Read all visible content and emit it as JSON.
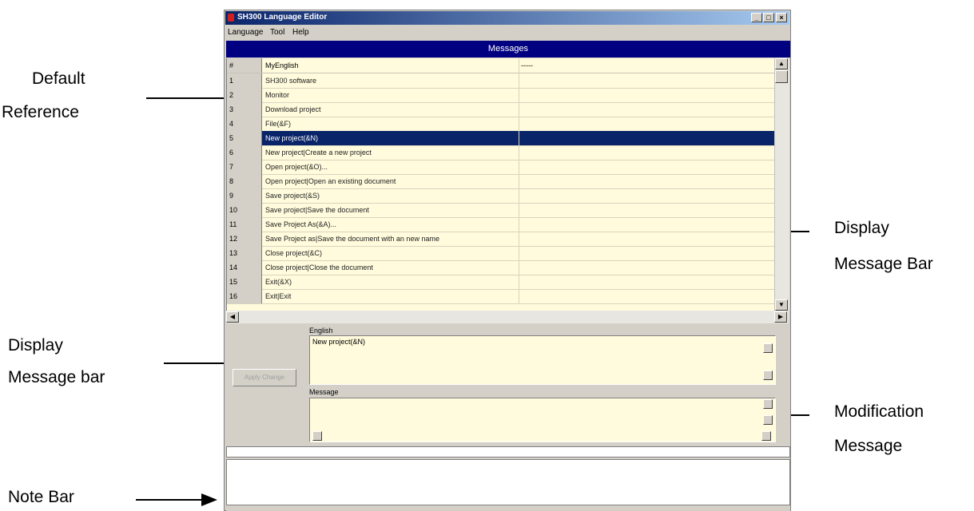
{
  "annotations": {
    "default_reference": [
      "Default",
      "Reference"
    ],
    "display_message_bar_right": [
      "Display",
      "Message Bar"
    ],
    "display_message_bar_left": [
      "Display",
      "Message bar"
    ],
    "modification_message": [
      "Modification",
      "Message"
    ],
    "note_bar": "Note Bar"
  },
  "window": {
    "title": "SH300 Language Editor",
    "controls": {
      "minimize": "_",
      "maximize": "□",
      "close": "×"
    }
  },
  "menu": [
    "Language",
    "Tool",
    "Help"
  ],
  "messages_header": "Messages",
  "grid": {
    "columns": [
      "#",
      "MyEnglish",
      "-----"
    ],
    "selected_row": 5,
    "rows": [
      {
        "num": "1",
        "text": "SH300 software"
      },
      {
        "num": "2",
        "text": "Monitor"
      },
      {
        "num": "3",
        "text": "Download project"
      },
      {
        "num": "4",
        "text": "File(&F)"
      },
      {
        "num": "5",
        "text": "New project(&N)"
      },
      {
        "num": "6",
        "text": "New project|Create a new project"
      },
      {
        "num": "7",
        "text": "Open project(&O)..."
      },
      {
        "num": "8",
        "text": "Open project|Open an existing document"
      },
      {
        "num": "9",
        "text": "Save project(&S)"
      },
      {
        "num": "10",
        "text": "Save project|Save the document"
      },
      {
        "num": "11",
        "text": "Save Project As(&A)..."
      },
      {
        "num": "12",
        "text": "Save Project as|Save the document with an new name"
      },
      {
        "num": "13",
        "text": "Close project(&C)"
      },
      {
        "num": "14",
        "text": "Close project|Close the document"
      },
      {
        "num": "15",
        "text": "Exit(&X)"
      },
      {
        "num": "16",
        "text": "Exit|Exit"
      }
    ]
  },
  "english_label": "English",
  "english_value": "New project(&N)",
  "message_label": "Message",
  "message_value": "",
  "apply_button": "Apply Change"
}
